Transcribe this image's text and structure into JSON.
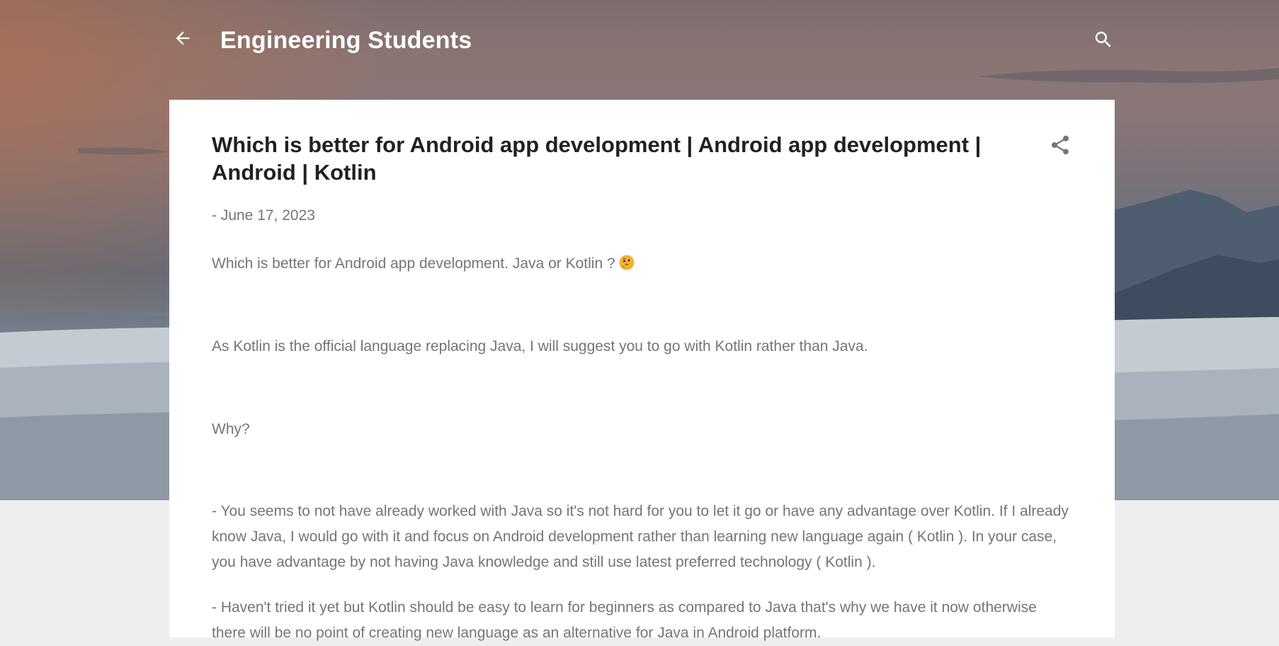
{
  "header": {
    "site_title": "Engineering Students",
    "back_icon": "arrow-left-icon",
    "search_icon": "search-icon"
  },
  "post": {
    "title": "Which is better for Android app development | Android app development | Android | Kotlin",
    "date": "- June 17, 2023",
    "share_icon": "share-icon",
    "paragraphs": [
      " Which is better for Android app development. Java or Kotlin ?",
      "As Kotlin is the official language replacing Java, I will suggest you to go with Kotlin rather than Java.",
      "Why?",
      "- You seems to not have already worked with Java so it's not hard for you to let it go or have any advantage over Kotlin. If I already know Java, I would go with it and focus on Android development rather than learning new language again ( Kotlin ). In your case, you have advantage by not having Java knowledge and still use latest preferred technology ( Kotlin ).",
      "- Haven't tried it yet but Kotlin should be easy to learn for beginners as compared to Java that's why we have it now otherwise there will be no point of creating new language as an alternative for Java in Android platform."
    ],
    "emoji_icon": "thinking-face-emoji-icon"
  },
  "colors": {
    "page_background": "#eeeeee",
    "card_background": "#ffffff",
    "title_text": "#212121",
    "body_text": "#757575",
    "header_text": "#ffffff"
  }
}
